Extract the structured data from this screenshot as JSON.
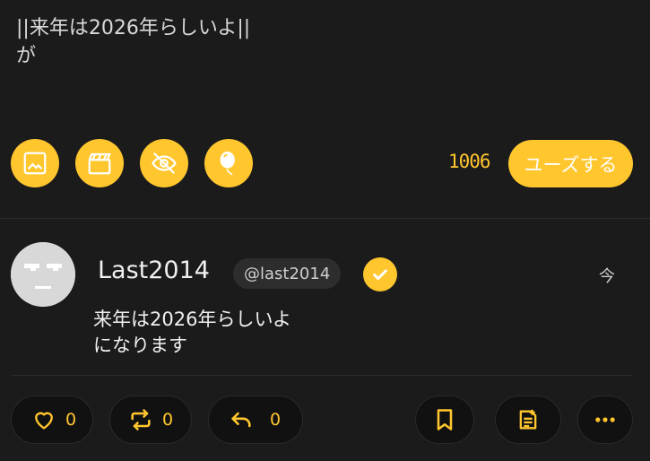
{
  "composer": {
    "text": "||来年は2026年らしいよ||\nが",
    "char_count": "1006",
    "post_label": "ユーズする"
  },
  "toolbar": {
    "icons": [
      "image-icon",
      "video-icon",
      "eye-off-icon",
      "balloon-icon"
    ]
  },
  "note": {
    "display_name": "Last2014",
    "username": "@last2014",
    "timestamp": "今",
    "text": "来年は2026年らしいよ\nになります"
  },
  "actions": {
    "like_count": "0",
    "renote_count": "0",
    "reply_count": "0"
  },
  "colors": {
    "accent": "#ffc62e",
    "background": "#1c1b1c"
  }
}
